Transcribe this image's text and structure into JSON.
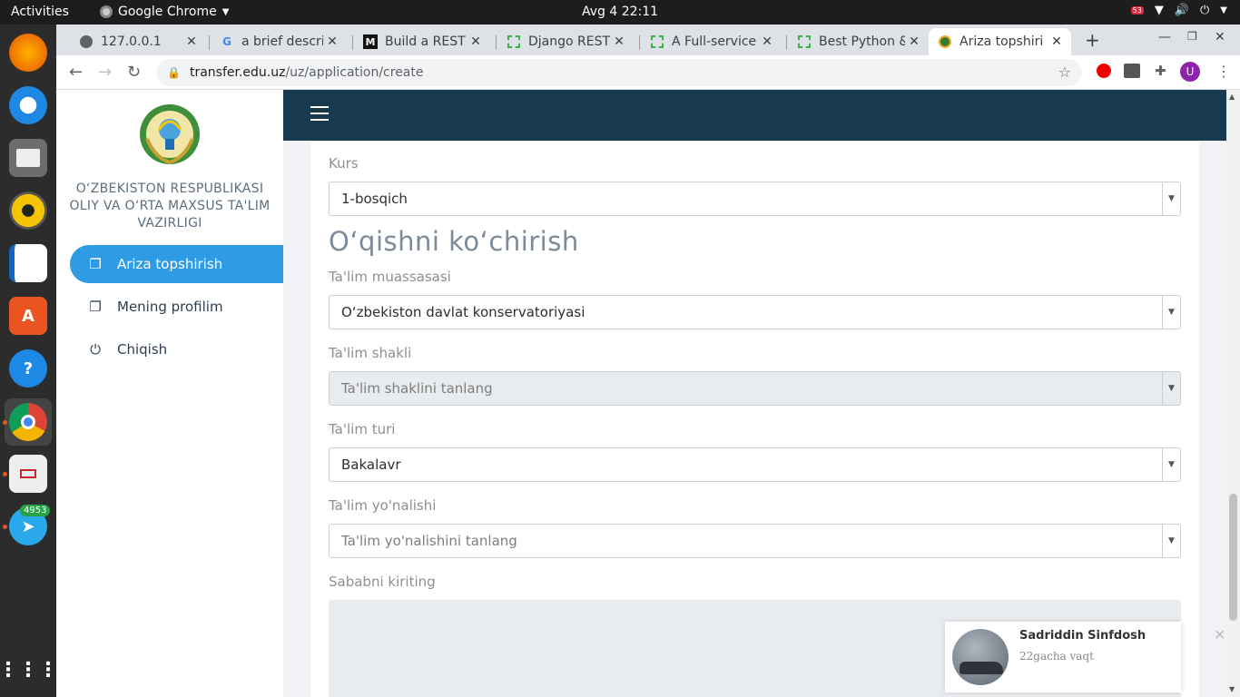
{
  "os": {
    "activities": "Activities",
    "app_name": "Google Chrome",
    "clock": "Avg 4  22:11",
    "tray_badge": "53"
  },
  "dock": {
    "items": [
      "firefox-icon",
      "thunderbird-icon",
      "files-icon",
      "rhythmbox-icon",
      "writer-icon",
      "software-center-icon",
      "help-icon",
      "chrome-icon",
      "document-viewer-icon",
      "telegram-icon"
    ],
    "telegram_badge": "4953",
    "apps_grid": "show-applications-icon"
  },
  "browser": {
    "tabs": [
      {
        "title": "127.0.0.1",
        "icon": "globe-icon"
      },
      {
        "title": "a brief descrip",
        "icon": "google-icon"
      },
      {
        "title": "Build a REST A",
        "icon": "medium-icon"
      },
      {
        "title": "Django REST A",
        "icon": "dotted-square-icon"
      },
      {
        "title": "A Full-service",
        "icon": "dotted-square-icon"
      },
      {
        "title": "Best Python &",
        "icon": "dotted-square-icon"
      },
      {
        "title": "Ariza topshiri",
        "icon": "emblem-icon"
      }
    ],
    "url_host": "transfer.edu.uz",
    "url_path": "/uz/application/create",
    "profile_initial": "U"
  },
  "sidebar": {
    "ministry": [
      "O‘ZBEKISTON RESPUBLIKASI",
      "OLIY VA O‘RTA MAXSUS TA'LIM",
      "VAZIRLIGI"
    ],
    "items": [
      {
        "label": "Ariza topshirish",
        "icon": "document-icon",
        "active": true
      },
      {
        "label": "Mening profilim",
        "icon": "document-icon",
        "active": false
      },
      {
        "label": "Chiqish",
        "icon": "power-icon",
        "active": false
      }
    ]
  },
  "form": {
    "kurs_label": "Kurs",
    "kurs_value": "1-bosqich",
    "section_title": "O‘qishni ko‘chirish",
    "muassasa_label": "Ta'lim muassasasi",
    "muassasa_value": "O‘zbekiston davlat konservatoriyasi",
    "shakl_label": "Ta'lim shakli",
    "shakl_placeholder": "Ta'lim shaklini tanlang",
    "turi_label": "Ta'lim turi",
    "turi_value": "Bakalavr",
    "yonalish_label": "Ta'lim yo'nalishi",
    "yonalish_placeholder": "Ta'lim yo'nalishini tanlang",
    "sabab_label": "Sababni kiriting"
  },
  "notification": {
    "name": "Sadriddin Sinfdosh",
    "message": "22gacha vaqt"
  },
  "colors": {
    "header": "#173a4f",
    "active_nav": "#2f9be4"
  }
}
